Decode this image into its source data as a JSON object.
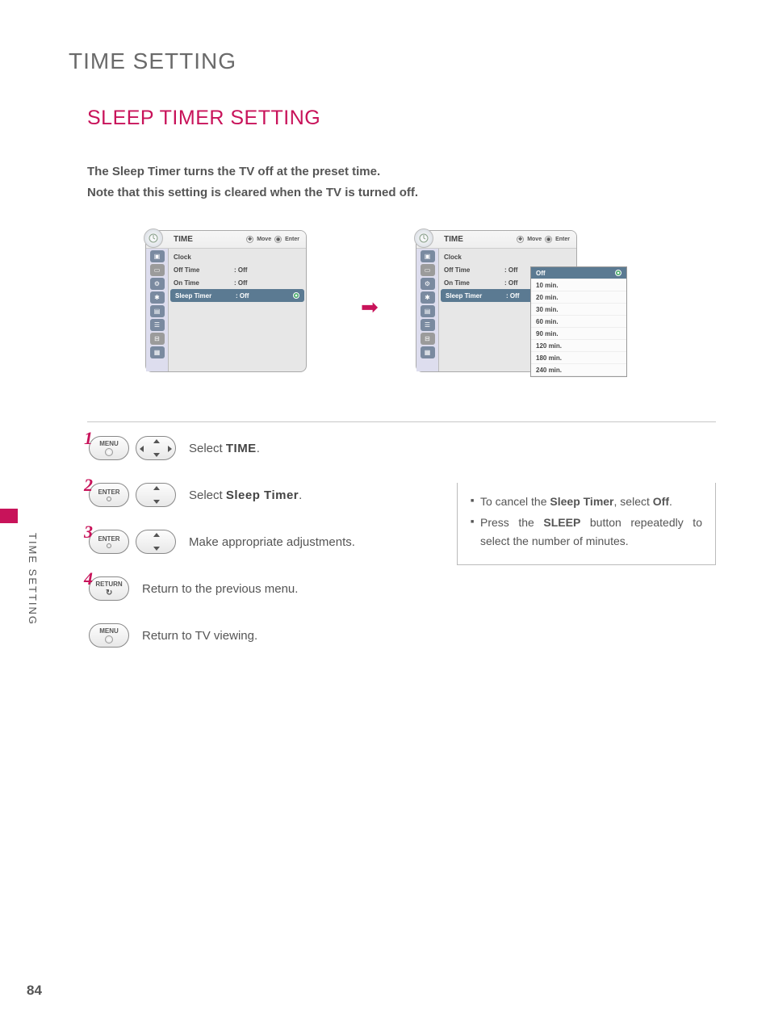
{
  "page_title": "TIME SETTING",
  "section_title": "SLEEP TIMER SETTING",
  "intro_line1": "The Sleep Timer turns the TV off at the preset time.",
  "intro_line2": "Note that this setting is cleared when the TV is turned off.",
  "osd": {
    "title": "TIME",
    "legend_move": "Move",
    "legend_enter": "Enter",
    "rows": [
      {
        "label": "Clock",
        "value": ""
      },
      {
        "label": "Off Time",
        "value": ": Off"
      },
      {
        "label": "On Time",
        "value": ": Off"
      },
      {
        "label": "Sleep Timer",
        "value": ": Off"
      }
    ]
  },
  "popup_options": [
    "Off",
    "10 min.",
    "20 min.",
    "30 min.",
    "60 min.",
    "90 min.",
    "120 min.",
    "180 min.",
    "240 min."
  ],
  "buttons": {
    "menu": "MENU",
    "enter": "ENTER",
    "return": "RETURN"
  },
  "steps": {
    "s1_pre": "Select ",
    "s1_b": "TIME",
    "s2_pre": "Select ",
    "s2_b": "Sleep Timer",
    "s3": "Make appropriate adjustments.",
    "s4": "Return to the previous menu.",
    "s5": "Return to TV viewing."
  },
  "info": {
    "li1_pre": "To cancel the ",
    "li1_b1": "Sleep Timer",
    "li1_mid": ", select ",
    "li1_b2": "Off",
    "li2_pre": "Press the ",
    "li2_b": "SLEEP",
    "li2_post": " button repeatedly to select the number of minutes."
  },
  "side_label": "TIME SETTING",
  "page_number": "84"
}
